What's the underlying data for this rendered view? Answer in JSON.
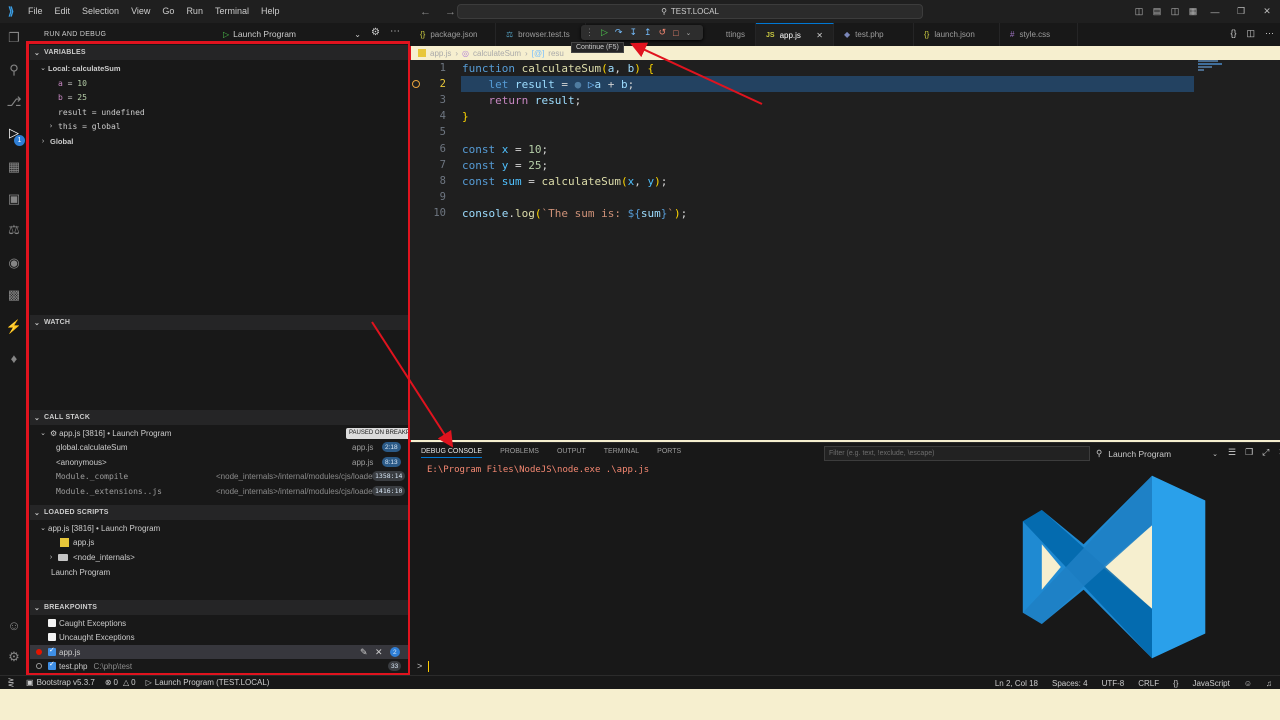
{
  "titlebar": {
    "menu": [
      "File",
      "Edit",
      "Selection",
      "View",
      "Go",
      "Run",
      "Terminal",
      "Help"
    ],
    "search": "TEST.LOCAL"
  },
  "sidebar": {
    "title": "RUN AND DEBUG",
    "launch_config": "Launch Program",
    "variables": {
      "header": "VARIABLES",
      "scope_local": "Local: calculateSum",
      "items": [
        {
          "name": "a",
          "eq": " = ",
          "value": "10"
        },
        {
          "name": "b",
          "eq": " = ",
          "value": "25"
        },
        {
          "name": "result",
          "eq": " = ",
          "value": "undefined"
        },
        {
          "name": "this",
          "eq": " = ",
          "value": "global"
        }
      ],
      "scope_global": "Global"
    },
    "watch": {
      "header": "WATCH"
    },
    "call_stack": {
      "header": "CALL STACK",
      "thread": "app.js [3816] • Launch Program",
      "paused": "PAUSED ON BREAKPOINT",
      "frames": [
        {
          "name": "global.calculateSum",
          "file": "app.js",
          "pos": "2:18"
        },
        {
          "name": "<anonymous>",
          "file": "app.js",
          "pos": "8:13"
        },
        {
          "name": "Module._compile",
          "file": "<node_internals>/internal/modules/cjs/loader",
          "pos": "1358:14"
        },
        {
          "name": "Module._extensions..js",
          "file": "<node_internals>/internal/modules/cjs/loader",
          "pos": "1416:10"
        }
      ]
    },
    "loaded_scripts": {
      "header": "LOADED SCRIPTS",
      "session": "app.js [3816] • Launch Program",
      "file": "app.js",
      "folder": "<node_internals>",
      "program": "Launch Program"
    },
    "breakpoints": {
      "header": "BREAKPOINTS",
      "caught": "Caught Exceptions",
      "uncaught": "Uncaught Exceptions",
      "items": [
        {
          "file": "app.js",
          "path": "",
          "count": "2"
        },
        {
          "file": "test.php",
          "path": "C:\\php\\test",
          "count": "33"
        }
      ]
    }
  },
  "tabs": [
    {
      "label": "package.json",
      "icon": "{}"
    },
    {
      "label": "browser.test.ts",
      "icon": "⚗"
    },
    {
      "label": "ttings",
      "icon": ""
    },
    {
      "label": "app.js",
      "icon": "JS",
      "active": true
    },
    {
      "label": "test.php",
      "icon": "◆"
    },
    {
      "label": "launch.json",
      "icon": "{}"
    },
    {
      "label": "style.css",
      "icon": "#"
    }
  ],
  "debug_toolbar": {
    "tooltip": "Continue (F5)"
  },
  "breadcrumb": {
    "file": "app.js",
    "symbol": "calculateSum",
    "sub": "resu"
  },
  "code": {
    "line_numbers": [
      "1",
      "2",
      "3",
      "4",
      "5",
      "6",
      "7",
      "8",
      "9",
      "10"
    ],
    "current_line": 2
  },
  "panel": {
    "tabs": [
      "DEBUG CONSOLE",
      "PROBLEMS",
      "OUTPUT",
      "TERMINAL",
      "PORTS"
    ],
    "filter_placeholder": "Filter (e.g. text, !exclude, \\escape)",
    "launch": "Launch Program",
    "console_output": "E:\\Program Files\\NodeJS\\node.exe .\\app.js",
    "prompt": ">"
  },
  "statusbar": {
    "bootstrap": "Bootstrap v5.3.7",
    "errors": "0",
    "warnings": "0",
    "launch": "Launch Program (TEST.LOCAL)",
    "position": "Ln 2, Col 18",
    "spaces": "Spaces: 4",
    "encoding": "UTF-8",
    "eol": "CRLF",
    "language": "JavaScript"
  },
  "colors": {
    "accent": "#0078d4",
    "annotation_red": "#e0131e",
    "logo_blue": "#0065a9"
  }
}
